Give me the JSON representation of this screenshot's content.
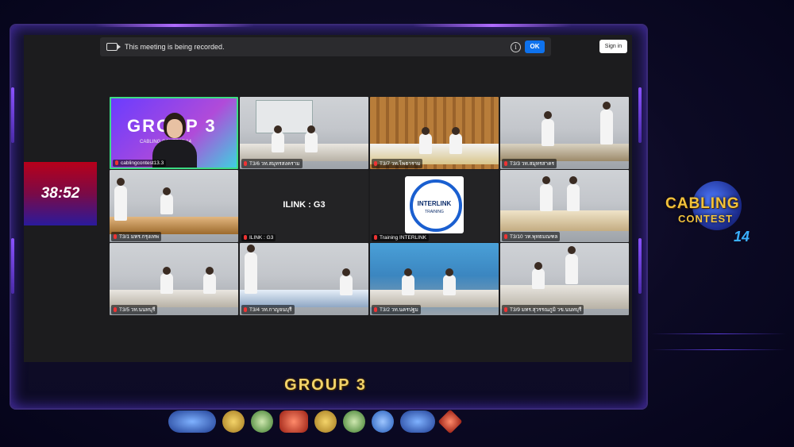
{
  "meeting": {
    "recording_notice": "This meeting is being recorded.",
    "ok_label": "OK",
    "info_icon": "i",
    "signin_label": "Sign in"
  },
  "timer": "38:52",
  "tiles": [
    {
      "id": "t1",
      "label": "cablingcontest13.3",
      "title": "GROUP 3",
      "subtitle": "CABLING CONTEST 14"
    },
    {
      "id": "t2",
      "label": "T3/6 วท.สมุทรสงคราม"
    },
    {
      "id": "t3",
      "label": "T3/7 วท.โพธาราม"
    },
    {
      "id": "t4",
      "label": "T3/3 วท.สมุทรสาคร"
    },
    {
      "id": "t5",
      "label": "T3/1 มทร.กรุงเทพ"
    },
    {
      "id": "t6",
      "label": "ILINK : G3",
      "name": "ILINK : G3"
    },
    {
      "id": "t7",
      "label": "Training INTERLINK",
      "logo_text": "INTERLINK",
      "logo_sub": "TRAINING"
    },
    {
      "id": "t8",
      "label": "T3/10 วท.พุทธมณฑล"
    },
    {
      "id": "t9",
      "label": "T3/5 วท.นนทบุรี"
    },
    {
      "id": "t10",
      "label": "T3/4 วท.กาญจนบุรี"
    },
    {
      "id": "t11",
      "label": "T3/2 วท.นครปฐม"
    },
    {
      "id": "t12",
      "label": "T3/9 มทร.สุวรรณภูมิ วข.นนทบุรี"
    }
  ],
  "branding": {
    "logo_line1": "CABLING",
    "logo_line2": "CONTEST",
    "logo_number": "14",
    "group_label": "GROUP 3"
  },
  "sponsors": [
    "interlink-logo",
    "seal-1",
    "seal-2",
    "anniversary-logo",
    "emblem-1",
    "emblem-2",
    "emblem-3",
    "link-logo",
    "diamond-logo"
  ]
}
